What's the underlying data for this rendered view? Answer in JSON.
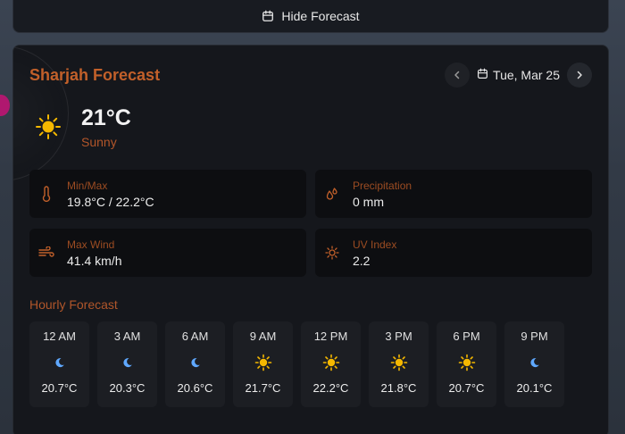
{
  "toggle": {
    "label": "Hide Forecast",
    "icon": "calendar-icon"
  },
  "forecast": {
    "title": "Sharjah Forecast",
    "date": "Tue, Mar 25",
    "current": {
      "temp": "21°C",
      "condition": "Sunny",
      "icon": "sun-icon"
    },
    "stats": {
      "minmax": {
        "label": "Min/Max",
        "value": "19.8°C / 22.2°C",
        "icon": "thermometer-icon"
      },
      "precip": {
        "label": "Precipitation",
        "value": "0 mm",
        "icon": "droplets-icon"
      },
      "wind": {
        "label": "Max Wind",
        "value": "41.4 km/h",
        "icon": "wind-icon"
      },
      "uv": {
        "label": "UV Index",
        "value": "2.2",
        "icon": "uv-sun-icon"
      }
    },
    "hourly_title": "Hourly Forecast",
    "hourly": [
      {
        "time": "12 AM",
        "temp": "20.7°C",
        "icon": "moon"
      },
      {
        "time": "3 AM",
        "temp": "20.3°C",
        "icon": "moon"
      },
      {
        "time": "6 AM",
        "temp": "20.6°C",
        "icon": "moon"
      },
      {
        "time": "9 AM",
        "temp": "21.7°C",
        "icon": "sun"
      },
      {
        "time": "12 PM",
        "temp": "22.2°C",
        "icon": "sun"
      },
      {
        "time": "3 PM",
        "temp": "21.8°C",
        "icon": "sun"
      },
      {
        "time": "6 PM",
        "temp": "20.7°C",
        "icon": "sun"
      },
      {
        "time": "9 PM",
        "temp": "20.1°C",
        "icon": "moon"
      }
    ]
  },
  "colors": {
    "accent": "#c2602a",
    "label": "#9c4c22",
    "sun": "#f5b800",
    "moon": "#5fa8ff"
  }
}
